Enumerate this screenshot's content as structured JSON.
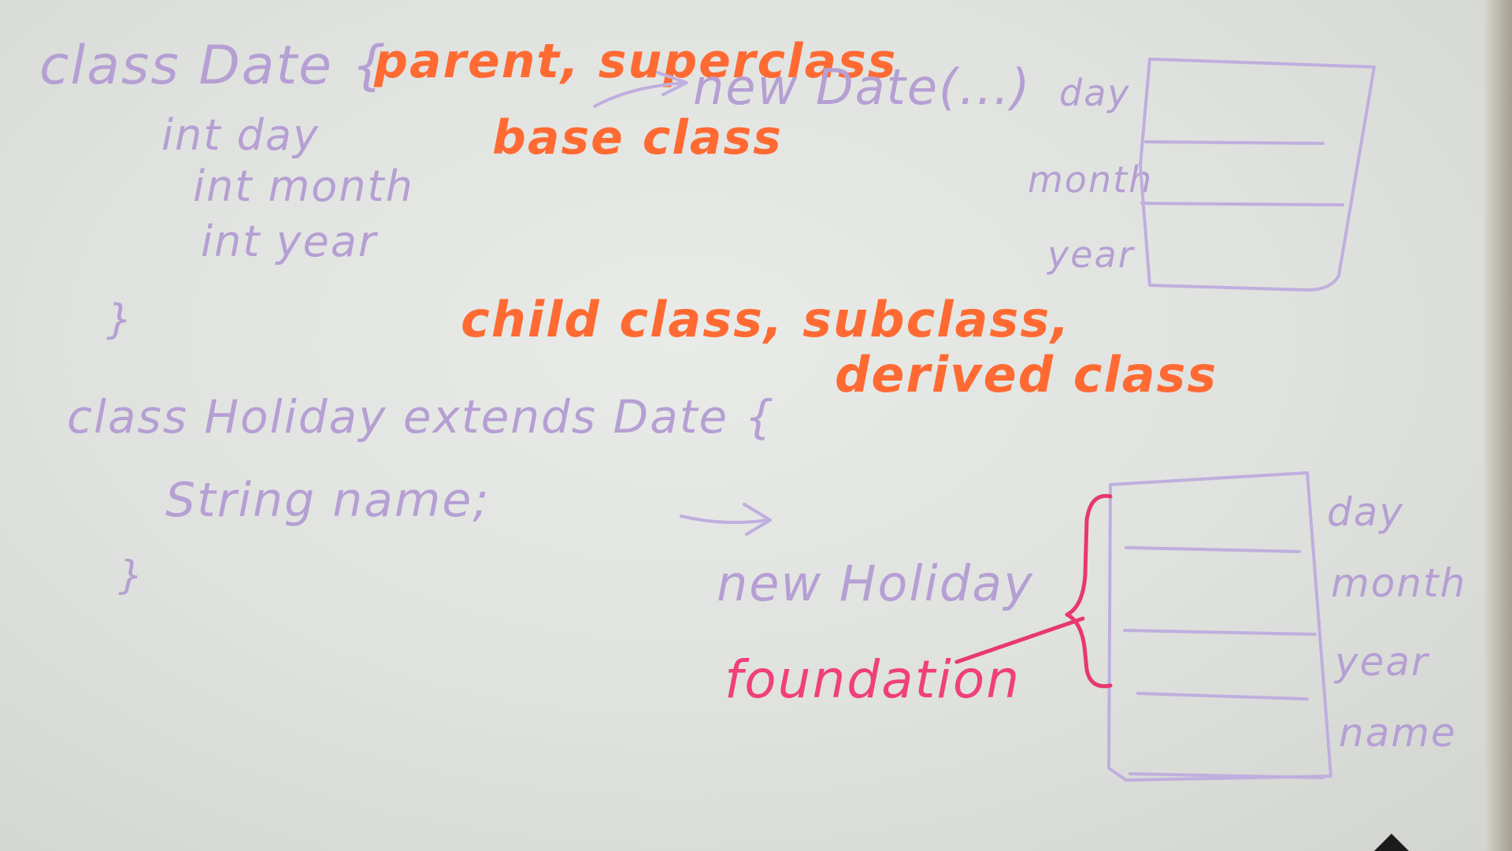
{
  "whiteboard": {
    "date_class": {
      "header": "class Date {",
      "fields": [
        "int day",
        "int month",
        "int year"
      ],
      "close": "}"
    },
    "parent_terms": {
      "line1": "parent, superclass",
      "line2": "base class"
    },
    "new_date": "new Date(...)",
    "date_memory_labels": [
      "day",
      "month",
      "year"
    ],
    "holiday_class": {
      "header": "class Holiday extends Date {",
      "field": "String name;",
      "close": "}"
    },
    "child_terms": {
      "line1": "child class, subclass,",
      "line2": "derived class"
    },
    "new_holiday": "new Holiday",
    "foundation": "foundation",
    "holiday_memory_labels": [
      "day",
      "month",
      "year",
      "name"
    ]
  },
  "colors": {
    "code_marker": "#b59fd3",
    "terms_marker": "#ff6a33",
    "foundation_marker": "#f0407a"
  }
}
